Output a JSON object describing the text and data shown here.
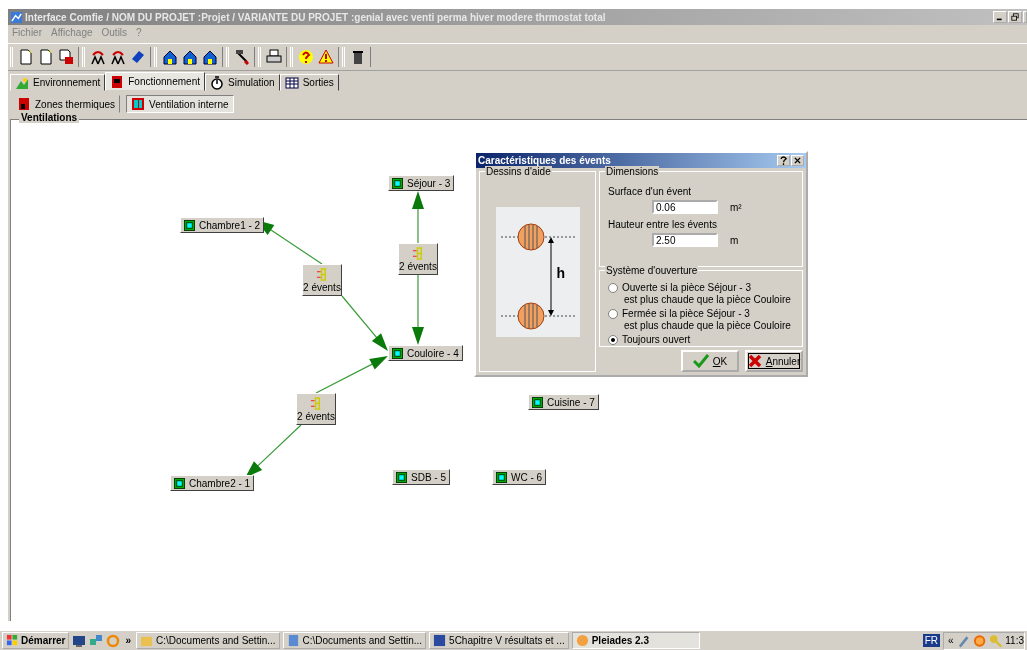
{
  "window": {
    "title": "Interface Comfie / NOM DU PROJET :Projet / VARIANTE DU PROJET :genial avec venti perma hiver modere thrmostat total"
  },
  "menu": [
    "Fichier",
    "Affichage",
    "Outils",
    "?"
  ],
  "tabs": [
    {
      "label": "Environnement",
      "selected": false
    },
    {
      "label": "Fonctionnement",
      "selected": true
    },
    {
      "label": "Simulation",
      "selected": false
    },
    {
      "label": "Sorties",
      "selected": false
    }
  ],
  "subtabs": [
    {
      "label": "Zones thermiques",
      "selected": false
    },
    {
      "label": "Ventilation interne",
      "selected": true
    }
  ],
  "group_title": "Ventilations",
  "rooms": [
    {
      "label": "Séjour - 3"
    },
    {
      "label": "Chambre1 - 2"
    },
    {
      "label": "Couloire - 4"
    },
    {
      "label": "Cuisine - 7"
    },
    {
      "label": "Chambre2 - 1"
    },
    {
      "label": "SDB - 5"
    },
    {
      "label": "WC - 6"
    }
  ],
  "vents": [
    {
      "label": "2 évents"
    },
    {
      "label": "2 évents"
    },
    {
      "label": "2 évents"
    }
  ],
  "dialog": {
    "title": "Caractéristiques des évents",
    "help_title": "Dessins d'aide",
    "help_drawing_label": "h",
    "dimensions_title": "Dimensions",
    "fields": [
      {
        "label": "Surface d'un évent",
        "value": "0.06",
        "unit": "m²"
      },
      {
        "label": "Hauteur entre les évents",
        "value": "2.50",
        "unit": "m"
      }
    ],
    "opening_title": "Système d'ouverture",
    "options": [
      {
        "line1": "Ouverte si la pièce Séjour - 3",
        "line2": "est plus chaude que la pièce Couloire",
        "selected": false
      },
      {
        "line1": "Fermée si la pièce Séjour - 3",
        "line2": "est plus chaude que la pièce Couloire",
        "selected": false
      },
      {
        "line1": "Toujours ouvert",
        "selected": true
      }
    ],
    "buttons": [
      {
        "label": "OK",
        "kind": "ok"
      },
      {
        "label": "Annuler",
        "kind": "cancel"
      }
    ]
  },
  "taskbar": {
    "start": "Démarrer",
    "more": "»",
    "tasks": [
      {
        "label": "C:\\Documents and Settin...",
        "kind": "folder",
        "selected": false
      },
      {
        "label": "C:\\Documents and Settin...",
        "kind": "explorer",
        "selected": false
      },
      {
        "label": "5Chapitre V  résultats et ...",
        "kind": "word",
        "selected": false
      },
      {
        "label": "Pleiades 2.3",
        "kind": "app",
        "selected": true
      }
    ],
    "language": "FR",
    "tray_toggle": "«",
    "clock": "11:3"
  }
}
